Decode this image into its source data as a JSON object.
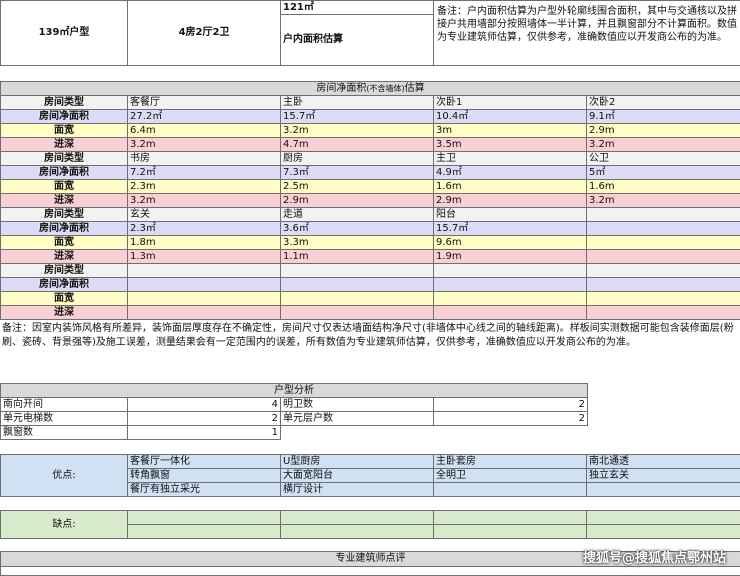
{
  "top": {
    "unit_type": "139㎡户型",
    "layout": "4房2厅2卫",
    "area_value": "121㎡",
    "area_label": "户内面积估算",
    "note": "备注：户内面积估算为户型外轮廓线围合面积，其中与交通核以及拼接户共用墙部分按照墙体一半计算，并且飘窗部分不计算面积。数值为专业建筑师估算，仅供参考，准确数值应以开发商公布的为准。"
  },
  "net_area": {
    "title": "房间净面积",
    "title_small": "(不含墙体)",
    "title_suffix": "估算",
    "row_labels": [
      "房间类型",
      "房间净面积",
      "面宽",
      "进深"
    ],
    "groups": [
      {
        "rooms": [
          "客餐厅",
          "主卧",
          "次卧1",
          "次卧2"
        ],
        "areas": [
          "27.2㎡",
          "15.7㎡",
          "10.4㎡",
          "9.1㎡"
        ],
        "widths": [
          "6.4m",
          "3.2m",
          "3m",
          "2.9m"
        ],
        "depths": [
          "3.2m",
          "4.7m",
          "3.5m",
          "3.2m"
        ]
      },
      {
        "rooms": [
          "书房",
          "厨房",
          "主卫",
          "公卫"
        ],
        "areas": [
          "7.2㎡",
          "7.3㎡",
          "4.9㎡",
          "5㎡"
        ],
        "widths": [
          "2.3m",
          "2.5m",
          "1.6m",
          "1.6m"
        ],
        "depths": [
          "3.2m",
          "2.9m",
          "2.9m",
          "3.2m"
        ]
      },
      {
        "rooms": [
          "玄关",
          "走道",
          "阳台",
          ""
        ],
        "areas": [
          "2.3㎡",
          "3.6㎡",
          "15.7㎡",
          ""
        ],
        "widths": [
          "1.8m",
          "3.3m",
          "9.6m",
          ""
        ],
        "depths": [
          "1.3m",
          "1.1m",
          "1.9m",
          ""
        ]
      },
      {
        "rooms": [
          "",
          "",
          "",
          ""
        ],
        "areas": [
          "",
          "",
          "",
          ""
        ],
        "widths": [
          "",
          "",
          "",
          ""
        ],
        "depths": [
          "",
          "",
          "",
          ""
        ]
      }
    ],
    "note": "备注：因室内装饰风格有所差异，装饰面层厚度存在不确定性，房间尺寸仅表达墙面结构净尺寸(非墙体中心线之间的轴线距离)。样板间实测数据可能包含装修面层(粉刷、瓷砖、背景强等)及施工误差，测量结果会有一定范围内的误差，所有数值为专业建筑师估算，仅供参考，准确数值应以开发商公布的为准。"
  },
  "analysis": {
    "title": "户型分析",
    "rows": [
      {
        "label1": "南向开间",
        "value1": "4",
        "label2": "明卫数",
        "value2": "2"
      },
      {
        "label1": "单元电梯数",
        "value1": "2",
        "label2": "单元层户数",
        "value2": "2"
      },
      {
        "label1": "飘窗数",
        "value1": "1",
        "label2": "",
        "value2": ""
      }
    ]
  },
  "pros": {
    "label": "优点:",
    "rows": [
      [
        "客餐厅一体化",
        "U型厨房",
        "主卧套房",
        "南北通透"
      ],
      [
        "转角飘窗",
        "大面宽阳台",
        "全明卫",
        "独立玄关"
      ],
      [
        "餐厅有独立采光",
        "横厅设计",
        "",
        ""
      ]
    ]
  },
  "cons": {
    "label": "缺点:"
  },
  "review": {
    "title": "专业建筑师点评"
  },
  "watermark": "搜狐号@搜狐焦点鄂州站"
}
